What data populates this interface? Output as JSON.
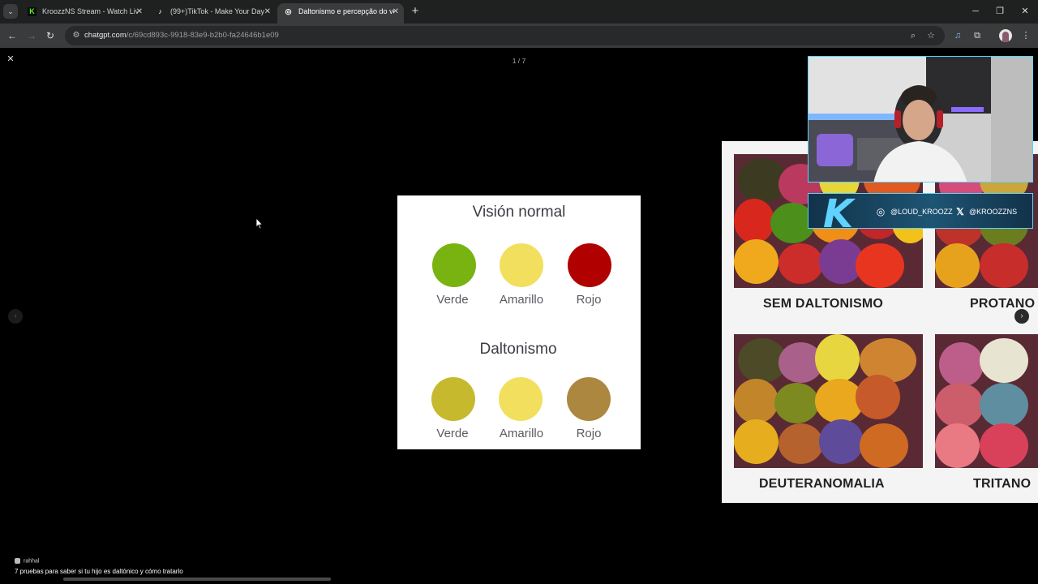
{
  "browser": {
    "tabs": [
      {
        "title": "KroozzNS Stream - Watch Live o",
        "favicon": "K",
        "favicon_color": "#53fc18",
        "active": false
      },
      {
        "title": "(99+)TikTok - Make Your Day",
        "favicon": "♪",
        "favicon_color": "#ffffff",
        "active": false
      },
      {
        "title": "Daltonismo e percepção do ver",
        "favicon": "◎",
        "favicon_color": "#ffffff",
        "active": true
      }
    ],
    "new_tab_icon": "plus-icon",
    "address": {
      "host": "chatgpt.com",
      "path": "/c/69cd893c-9918-83e9-b2b0-fa24646b1e09"
    },
    "window_controls": [
      "minimize",
      "restore",
      "close"
    ]
  },
  "viewer": {
    "counter": "1 / 7",
    "card": {
      "normal_heading": "Visión normal",
      "normal_circles": [
        {
          "label": "Verde",
          "color": "#79b311"
        },
        {
          "label": "Amarillo",
          "color": "#f2df5e"
        },
        {
          "label": "Rojo",
          "color": "#b10000"
        }
      ],
      "dalt_heading": "Daltonismo",
      "dalt_circles": [
        {
          "label": "Verde",
          "color": "#c6b92e"
        },
        {
          "label": "Amarillo",
          "color": "#f2df5e"
        },
        {
          "label": "Rojo",
          "color": "#ac8740"
        }
      ]
    },
    "background_panel": {
      "labels": [
        "SEM DALTONISMO",
        "PROTANO",
        "DEUTERANOMALIA",
        "TRITANO"
      ]
    }
  },
  "stream_overlay": {
    "instagram_handle": "@LOUD_KROOZZ",
    "x_handle": "@KROOZZNS",
    "logo_letter": "K"
  },
  "bottom": {
    "source": "rahhal",
    "caption": "7 pruebas para saber si tu hijo es daltónico y cómo tratarlo"
  }
}
